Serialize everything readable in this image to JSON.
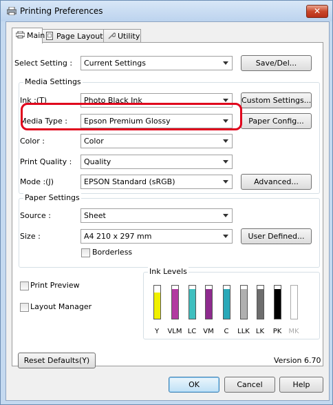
{
  "window": {
    "title": "Printing Preferences",
    "close_glyph": "✕"
  },
  "tabs": [
    {
      "label": "Main",
      "icon": "printer-icon",
      "active": true
    },
    {
      "label": "Page Layout",
      "icon": "page-icon",
      "active": false
    },
    {
      "label": "Utility",
      "icon": "wrench-icon",
      "active": false
    }
  ],
  "select_setting": {
    "label": "Select Setting :",
    "value": "Current Settings",
    "button": "Save/Del..."
  },
  "media_settings": {
    "title": "Media Settings",
    "ink": {
      "label": "Ink :(T)",
      "value": "Photo Black Ink",
      "button": "Custom Settings..."
    },
    "media_type": {
      "label": "Media Type :",
      "value": "Epson Premium Glossy",
      "button": "Paper Config..."
    },
    "color": {
      "label": "Color :",
      "value": "Color"
    },
    "print_quality": {
      "label": "Print Quality :",
      "value": "Quality"
    },
    "mode": {
      "label": "Mode :(J)",
      "value": "EPSON Standard (sRGB)",
      "button": "Advanced..."
    }
  },
  "paper_settings": {
    "title": "Paper Settings",
    "source": {
      "label": "Source :",
      "value": "Sheet"
    },
    "size": {
      "label": "Size :",
      "value": "A4 210 x 297 mm",
      "button": "User Defined..."
    },
    "borderless": "Borderless"
  },
  "print_preview": "Print Preview",
  "layout_manager": "Layout Manager",
  "ink_levels": {
    "title": "Ink Levels",
    "cartridges": [
      {
        "label": "Y",
        "color": "#f0f000",
        "level": 0.8
      },
      {
        "label": "VLM",
        "color": "#b23aa0",
        "level": 0.9
      },
      {
        "label": "LC",
        "color": "#3fbfbf",
        "level": 0.9
      },
      {
        "label": "VM",
        "color": "#8e2b8e",
        "level": 0.9
      },
      {
        "label": "C",
        "color": "#2aa8b8",
        "level": 0.9
      },
      {
        "label": "LLK",
        "color": "#b0b0b0",
        "level": 0.9
      },
      {
        "label": "LK",
        "color": "#6d6d6d",
        "level": 0.9
      },
      {
        "label": "PK",
        "color": "#000000",
        "level": 0.9
      },
      {
        "label": "MK",
        "color": "#ffffff",
        "level": 0.0,
        "disabled": true
      }
    ]
  },
  "reset_defaults": "Reset Defaults(Y)",
  "version": "Version 6.70",
  "footer": {
    "ok": "OK",
    "cancel": "Cancel",
    "help": "Help"
  },
  "colors": {
    "highlight": "#e0001b",
    "window_frame": "#c4d9f0"
  }
}
